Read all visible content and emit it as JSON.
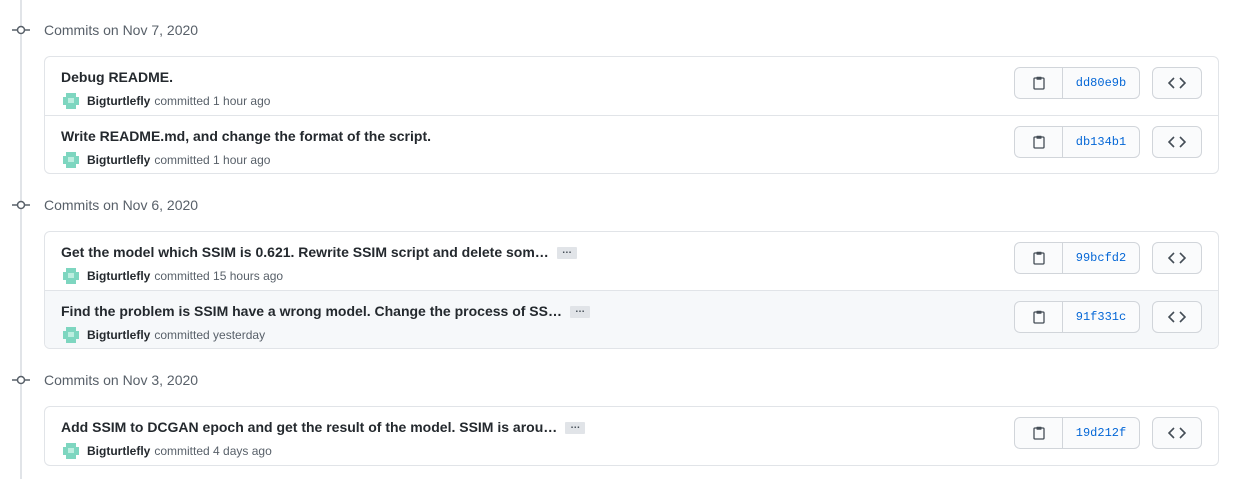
{
  "groups": [
    {
      "title": "Commits on Nov 7, 2020",
      "commits": [
        {
          "message": "Debug README.",
          "truncated": false,
          "author": "Bigturtlefly",
          "verb": "committed",
          "time": "1 hour ago",
          "sha": "dd80e9b"
        },
        {
          "message": "Write README.md, and change the format of the script.",
          "truncated": false,
          "author": "Bigturtlefly",
          "verb": "committed",
          "time": "1 hour ago",
          "sha": "db134b1"
        }
      ]
    },
    {
      "title": "Commits on Nov 6, 2020",
      "commits": [
        {
          "message": "Get the model which SSIM is 0.621. Rewrite SSIM script and delete som…",
          "truncated": true,
          "author": "Bigturtlefly",
          "verb": "committed",
          "time": "15 hours ago",
          "sha": "99bcfd2"
        },
        {
          "message": "Find the problem is SSIM have a wrong model. Change the process of SS…",
          "truncated": true,
          "author": "Bigturtlefly",
          "verb": "committed",
          "time": "yesterday",
          "sha": "91f331c"
        }
      ]
    },
    {
      "title": "Commits on Nov 3, 2020",
      "commits": [
        {
          "message": "Add SSIM to DCGAN epoch and get the result of the model. SSIM is arou…",
          "truncated": true,
          "author": "Bigturtlefly",
          "verb": "committed",
          "time": "4 days ago",
          "sha": "19d212f"
        }
      ]
    }
  ],
  "ellipsis_label": "…",
  "icons": {
    "commit": "git-commit-icon",
    "copy": "clipboard-icon",
    "browse": "code-icon",
    "avatar": "identicon-avatar"
  },
  "colors": {
    "link": "#0366d6",
    "muted": "#586069",
    "border": "#e1e4e8",
    "avatar": "#7ed6c0"
  }
}
